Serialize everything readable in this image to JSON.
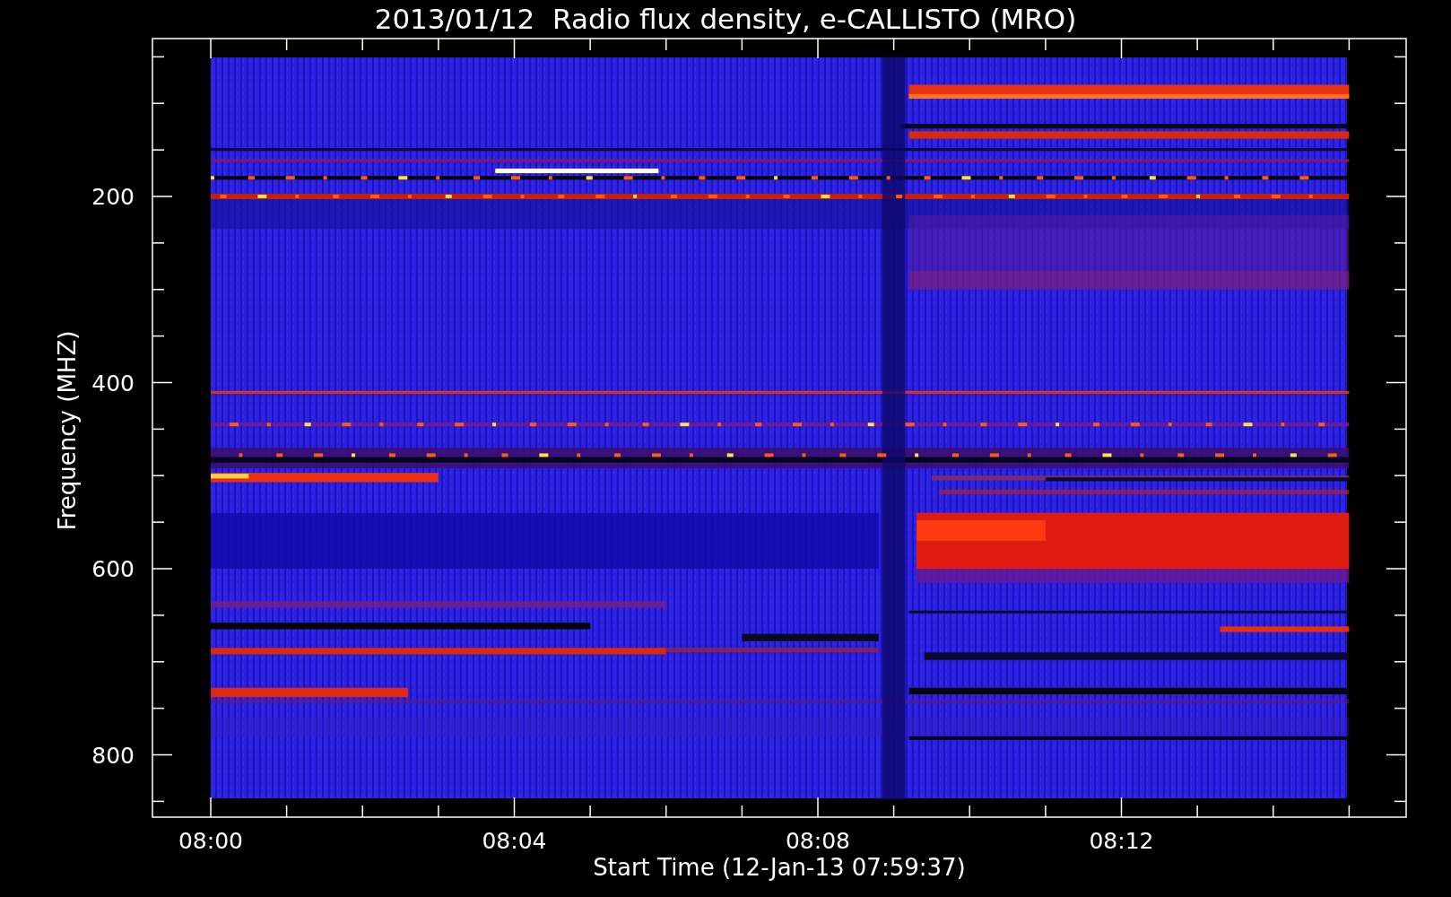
{
  "title": "2013/01/12  Radio flux density, e-CALLISTO (MRO)",
  "y_axis": {
    "label": "Frequency (MHZ)",
    "ticks": [
      "200",
      "400",
      "600",
      "800"
    ]
  },
  "x_axis": {
    "label": "Start Time (12-Jan-13 07:59:37)",
    "ticks": [
      "08:00",
      "08:04",
      "08:08",
      "08:12"
    ]
  }
}
